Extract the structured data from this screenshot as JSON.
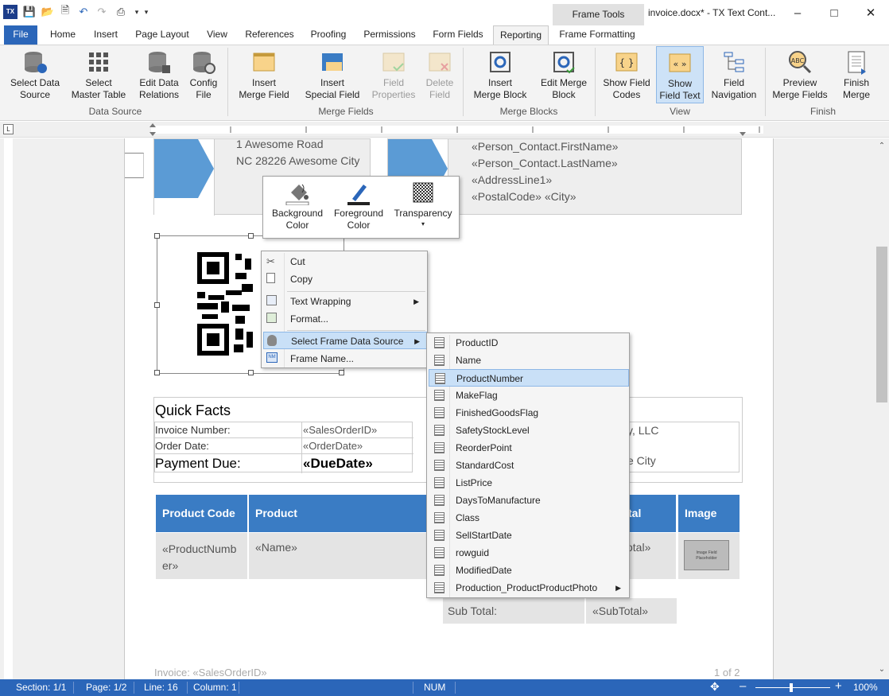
{
  "app": {
    "window_title": "invoice.docx* - TX Text Cont...",
    "context_group": "Frame Tools"
  },
  "tabs": [
    "File",
    "Home",
    "Insert",
    "Page Layout",
    "View",
    "References",
    "Proofing",
    "Permissions",
    "Form Fields",
    "Reporting",
    "Frame Formatting"
  ],
  "ribbon": {
    "data_source": {
      "label": "Data Source",
      "select_data": "Select Data\nSource",
      "select_master": "Select\nMaster Table",
      "edit_relations": "Edit Data\nRelations",
      "config_file": "Config\nFile"
    },
    "merge_fields": {
      "label": "Merge Fields",
      "insert_merge_field": "Insert\nMerge Field",
      "insert_special_field": "Insert\nSpecial Field",
      "field_properties": "Field\nProperties",
      "delete_field": "Delete\nField"
    },
    "merge_blocks": {
      "label": "Merge Blocks",
      "insert_merge_block": "Insert\nMerge Block",
      "edit_merge_block": "Edit Merge\nBlock"
    },
    "view": {
      "label": "View",
      "show_field_codes": "Show Field\nCodes",
      "show_field_text": "Show\nField Text",
      "field_navigation": "Field\nNavigation"
    },
    "finish": {
      "label": "Finish",
      "preview_merge_fields": "Preview\nMerge Fields",
      "finish_merge": "Finish\nMerge"
    }
  },
  "document": {
    "address_left": [
      "1 Awesome Road",
      "NC 28226 Awesome City"
    ],
    "address_right": [
      "«Person_Contact.FirstName»",
      "«Person_Contact.LastName»",
      "«AddressLine1»",
      "«PostalCode» «City»"
    ],
    "quick_facts_title": "Quick Facts",
    "facts": [
      {
        "label": "Invoice Number:",
        "value": "«SalesOrderID»"
      },
      {
        "label": "Order Date:",
        "value": "«OrderDate»"
      },
      {
        "label": "Payment Due:",
        "value": "«DueDate»"
      }
    ],
    "company_partial": [
      "y, LLC",
      "e City"
    ],
    "table_headers": [
      "Product Code",
      "Product",
      "tal",
      "Image"
    ],
    "table_row": [
      "«ProductNumb\ner»",
      "«Name»",
      "otal»",
      "Image Field\nPlaceholder"
    ],
    "subtotal_label": "Sub Total:",
    "subtotal_value": "«SubTotal»",
    "footer_left": "Invoice: «SalesOrderID»",
    "footer_right": "1 of 2"
  },
  "mini_toolbar": {
    "background": "Background\nColor",
    "foreground": "Foreground\nColor",
    "transparency": "Transparency"
  },
  "context_menu": [
    "Cut",
    "Copy",
    "Text Wrapping",
    "Format...",
    "Select Frame Data Source",
    "Frame Name..."
  ],
  "submenu": [
    "ProductID",
    "Name",
    "ProductNumber",
    "MakeFlag",
    "FinishedGoodsFlag",
    "SafetyStockLevel",
    "ReorderPoint",
    "StandardCost",
    "ListPrice",
    "DaysToManufacture",
    "Class",
    "SellStartDate",
    "rowguid",
    "ModifiedDate",
    "Production_ProductProductPhoto"
  ],
  "status": {
    "section": "Section: 1/1",
    "page": "Page: 1/2",
    "line": "Line: 16",
    "column": "Column: 1",
    "num": "NUM",
    "zoom": "100%"
  },
  "colors": {
    "accent": "#2b66b9",
    "header_blue": "#3a7cc4",
    "highlight": "#c9e0f7"
  }
}
